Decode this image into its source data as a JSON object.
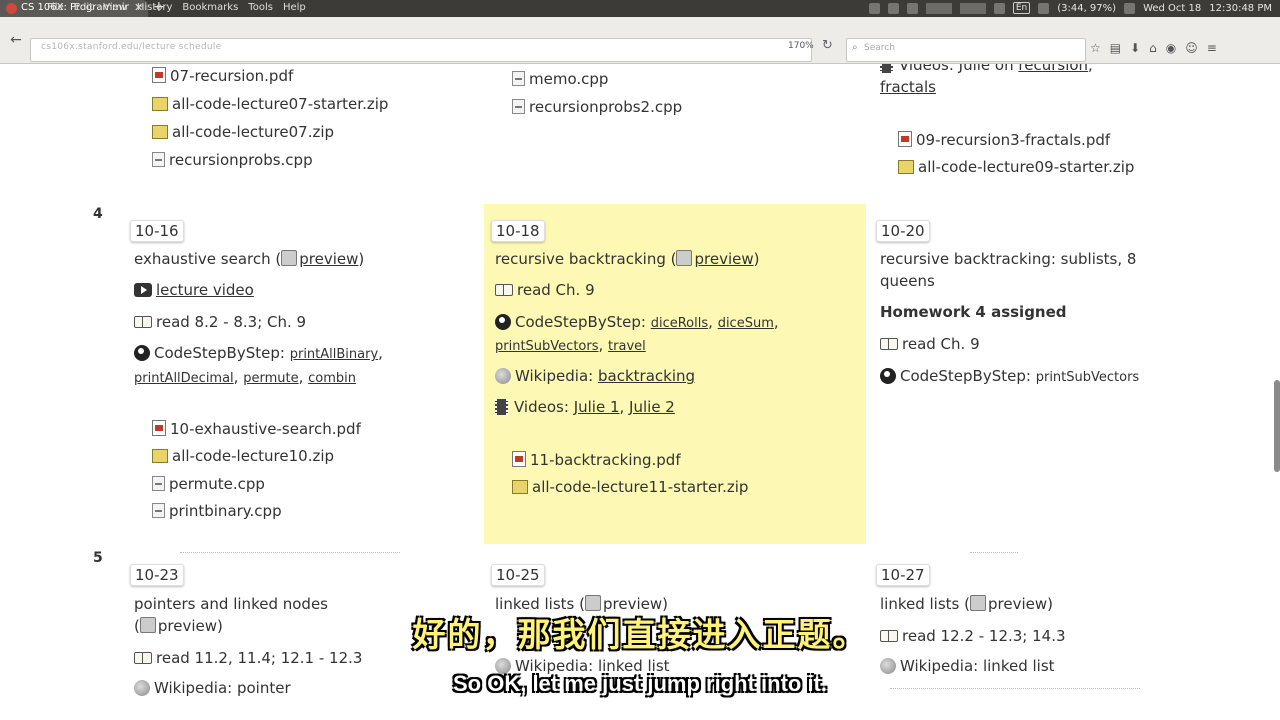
{
  "os": {
    "tab_title": "CS 106X: Programmin",
    "tab_close": "✕",
    "new_tab": "+",
    "menus": [
      "File",
      "Edit",
      "View",
      "History",
      "Bookmarks",
      "Tools",
      "Help"
    ],
    "lang": "En",
    "battery": "(3:44, 97%)",
    "datetime": "Wed Oct 18",
    "time": "12:30:48 PM"
  },
  "browser": {
    "back": "←",
    "url": "cs106x.stanford.edu/lecture schedule",
    "zoom": "170%",
    "reload": "↻",
    "search_placeholder": "Search",
    "search_icon": "search-icon",
    "toolbar": [
      "☆",
      "▤",
      "⬇",
      "⌂",
      "◉",
      "☺",
      "≡"
    ]
  },
  "week3_tail": {
    "col1_files": [
      "07-recursion.pdf",
      "all-code-lecture07-starter.zip",
      "all-code-lecture07.zip",
      "recursionprobs.cpp"
    ],
    "col2_files": [
      "memo.cpp",
      "recursionprobs2.cpp"
    ],
    "col3_videos_prefix": "Videos: Julie on",
    "col3_videos_links": [
      "recursion",
      "fractals"
    ],
    "col3_files": [
      "09-recursion3-fractals.pdf",
      "all-code-lecture09-starter.zip"
    ]
  },
  "week4": {
    "num": "4",
    "mon": {
      "date": "10-16",
      "title": "exhaustive search (",
      "preview": "preview",
      "title_end": ")",
      "video": "lecture video",
      "read": "read 8.2 - 8.3; Ch. 9",
      "codestep_label": "CodeStepByStep:",
      "codestep_links": [
        "printAllBinary",
        "printAllDecimal",
        "permute",
        "combin"
      ],
      "files": [
        "10-exhaustive-search.pdf",
        "all-code-lecture10.zip",
        "permute.cpp",
        "printbinary.cpp"
      ]
    },
    "wed": {
      "date": "10-18",
      "title": "recursive backtracking (",
      "preview": "preview",
      "title_end": ")",
      "read": "read Ch. 9",
      "codestep_label": "CodeStepByStep:",
      "codestep_links": [
        "diceRolls",
        "diceSum",
        "printSubVectors",
        "travel"
      ],
      "wiki_label": "Wikipedia:",
      "wiki_link": "backtracking",
      "videos_label": "Videos:",
      "videos_links": [
        "Julie 1",
        "Julie 2"
      ],
      "files": [
        "11-backtracking.pdf",
        "all-code-lecture11-starter.zip"
      ]
    },
    "fri": {
      "date": "10-20",
      "title_line1": "recursive backtracking: sublists, 8",
      "title_line2": "queens",
      "homework": "Homework 4 assigned",
      "read": "read Ch. 9",
      "codestep_label": "CodeStepByStep:",
      "codestep_links": [
        "printSubVectors"
      ]
    }
  },
  "week5": {
    "num": "5",
    "mon": {
      "date": "10-23",
      "title": "pointers and linked nodes",
      "preview_open": "(",
      "preview": "preview)",
      "read": "read 11.2, 11.4; 12.1 - 12.3",
      "wiki": "Wikipedia: pointer"
    },
    "wed": {
      "date": "10-25",
      "title": "linked lists (",
      "preview": "preview)",
      "wiki": "Wikipedia: linked list"
    },
    "fri": {
      "date": "10-27",
      "title": "linked lists (",
      "preview": "preview)",
      "read": "read 12.2 - 12.3; 14.3",
      "wiki": "Wikipedia: linked list"
    }
  },
  "subtitles": {
    "zh": "好的，那我们直接进入正题。",
    "en": "So OK, let me just jump right into it."
  },
  "colors": {
    "highlight": "#fdf9b4",
    "subtitle_zh": "#fff27a",
    "os_bar": "#3c3b37"
  }
}
